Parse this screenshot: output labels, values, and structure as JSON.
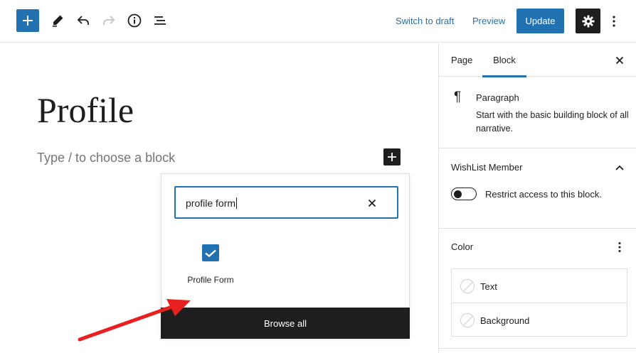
{
  "toolbar": {
    "inserter_icon": "plus-icon",
    "tools_icon": "pencil-icon",
    "undo_icon": "undo-icon",
    "redo_icon": "redo-icon",
    "details_icon": "info-icon",
    "outline_icon": "list-view-icon",
    "switch_to_draft": "Switch to draft",
    "preview": "Preview",
    "update": "Update",
    "settings_icon": "gear-icon",
    "options_icon": "more-vertical-icon"
  },
  "editor": {
    "title": "Profile",
    "placeholder": "Type / to choose a block"
  },
  "quick_inserter": {
    "search_value": "profile form",
    "results": [
      {
        "label": "Profile Form",
        "icon": "profile-form-icon"
      }
    ],
    "browse_all": "Browse all"
  },
  "sidebar": {
    "tabs": [
      {
        "label": "Page",
        "active": false
      },
      {
        "label": "Block",
        "active": true
      }
    ],
    "block_card": {
      "icon": "paragraph-icon",
      "name": "Paragraph",
      "description": "Start with the basic building block of all narrative."
    },
    "wishlist": {
      "title": "WishList Member",
      "toggle_label": "Restrict access to this block.",
      "toggle_on": false
    },
    "color": {
      "title": "Color",
      "items": [
        {
          "label": "Text"
        },
        {
          "label": "Background"
        }
      ]
    }
  },
  "colors": {
    "accent": "#2271b1",
    "dark": "#1e1e1e",
    "annotation_arrow": "#e82020"
  }
}
